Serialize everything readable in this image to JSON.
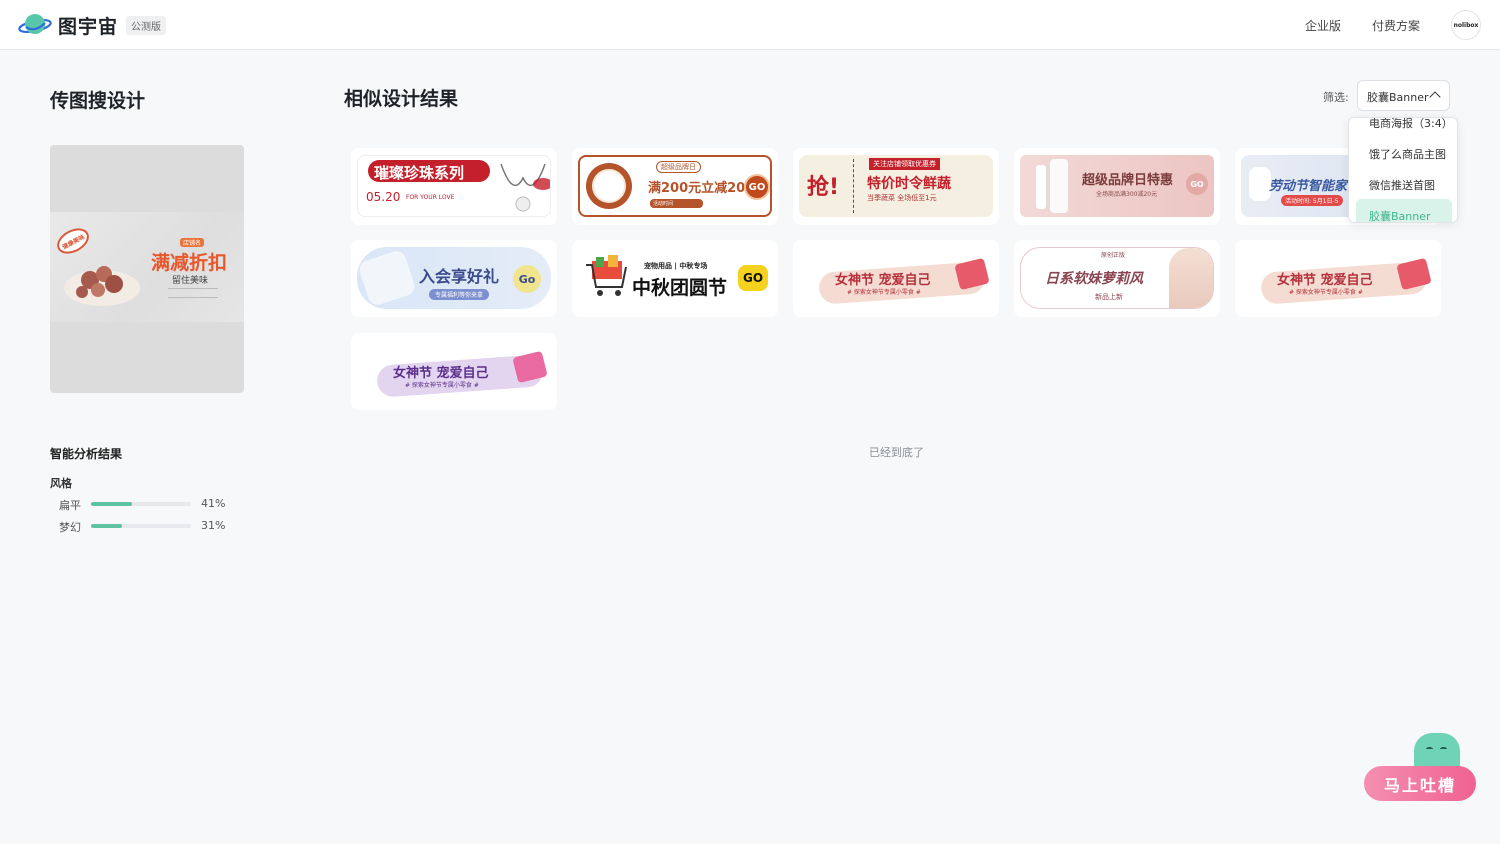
{
  "header": {
    "logo_text": "图宇宙",
    "beta": "公测版",
    "nav": [
      "企业版",
      "付费方案"
    ],
    "avatar_text": "nolibox"
  },
  "left": {
    "title": "传图搜设计",
    "preview": {
      "badge": "健康美味",
      "tag": "店铺名",
      "headline": "满减折扣",
      "sub": "留住美味"
    },
    "analysis_title": "智能分析结果",
    "style_label": "风格",
    "styles": [
      {
        "name": "扁平",
        "pct_text": "41%",
        "value": 0.41
      },
      {
        "name": "梦幻",
        "pct_text": "31%",
        "value": 0.31
      }
    ]
  },
  "main": {
    "title": "相似设计结果",
    "filter_label": "筛选:",
    "filter_value": "胶囊Banner",
    "end_text": "已经到底了",
    "cards": [
      {
        "t1": "璀璨珍珠系列",
        "t2": "05.20",
        "t3": "FOR YOUR LOVE"
      },
      {
        "t1": "满200元立减20",
        "t2": "超级品牌日",
        "t3": "活动时间",
        "go": "GO"
      },
      {
        "t1": "特价时令鲜蔬",
        "t2": "关注店铺领取优惠券",
        "t3": "当季蔬菜 全场低至1元",
        "big": "抢!"
      },
      {
        "t1": "超级品牌日特惠",
        "t2": "全场商品满300减20元",
        "go": "GO"
      },
      {
        "t1": "劳动节智能家",
        "t2": "活动时间: 5月1日-5"
      },
      {
        "t1": "入会享好礼",
        "t2": "专属福利等你来拿",
        "go": "Go"
      },
      {
        "t1": "中秋团圆节",
        "t2": "宠物用品 | 中秋专场",
        "go": "GO"
      },
      {
        "t1": "女神节 宠爱自己",
        "t2": "# 探索女神节专属小零食 #"
      },
      {
        "t1": "日系软妹萝莉风",
        "t2": "原创正版",
        "t3": "新品上新"
      },
      {
        "t1": "女神节 宠爱自己",
        "t2": "# 探索女神节专属小零食 #"
      },
      {
        "t1": "女神节 宠爱自己",
        "t2": "# 探索女神节专属小零食 #"
      }
    ]
  },
  "dropdown": {
    "items": [
      "电商海报（3:4）",
      "饿了么商品主图",
      "微信推送首图",
      "胶囊Banner"
    ],
    "selected": "胶囊Banner"
  },
  "feedback": {
    "label": "马上吐槽"
  }
}
